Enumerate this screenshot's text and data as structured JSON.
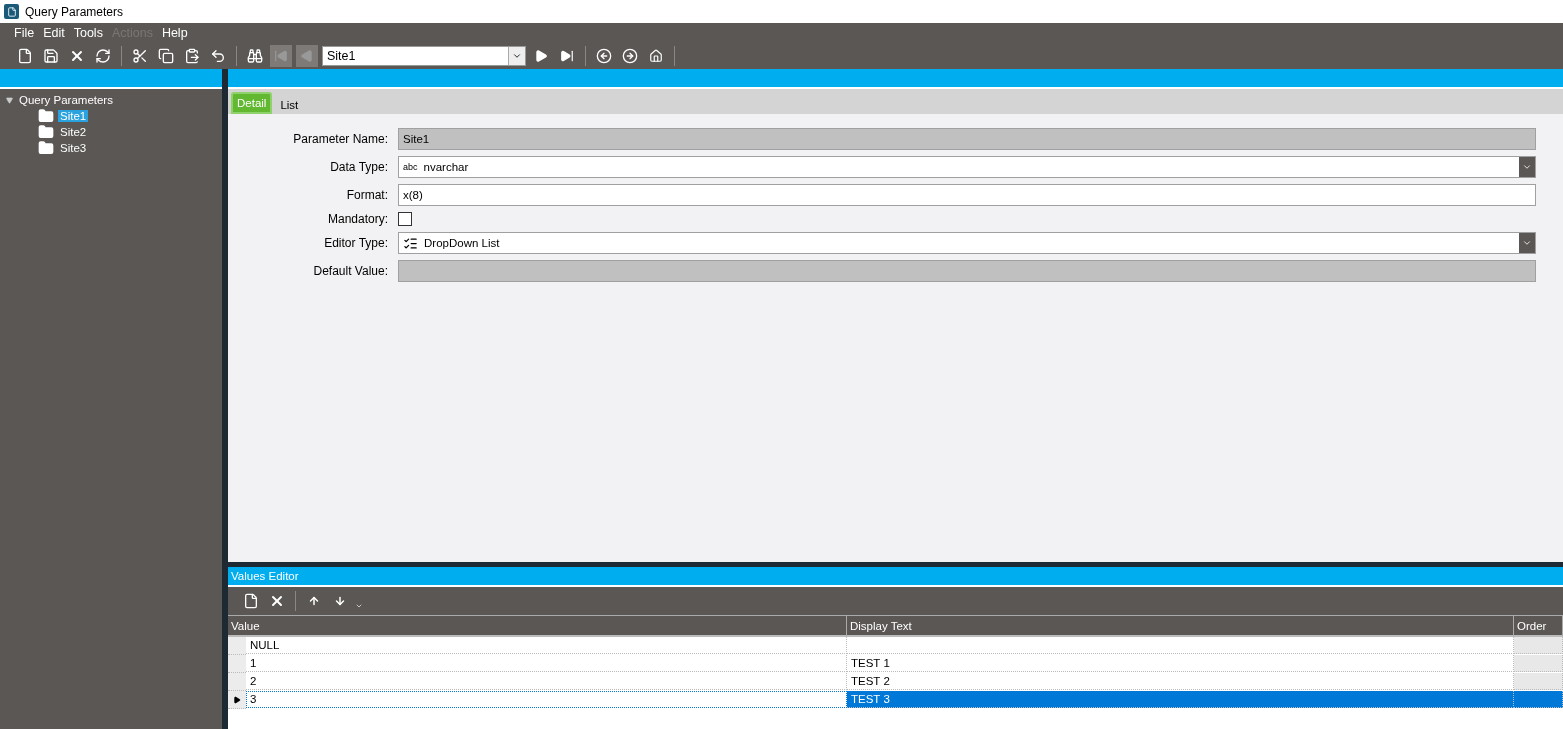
{
  "window": {
    "title": "Query Parameters"
  },
  "menu": [
    {
      "label": "File",
      "disabled": false
    },
    {
      "label": "Edit",
      "disabled": false
    },
    {
      "label": "Tools",
      "disabled": false
    },
    {
      "label": "Actions",
      "disabled": true
    },
    {
      "label": "Help",
      "disabled": false
    }
  ],
  "toolbar": {
    "nav_before": [
      {
        "kind": "first",
        "disabled": true
      },
      {
        "kind": "prev",
        "disabled": true
      }
    ],
    "record": "Site1",
    "nav_after": [
      {
        "kind": "next",
        "disabled": false
      },
      {
        "kind": "last",
        "disabled": false
      }
    ]
  },
  "tree": {
    "label": "Query Parameters",
    "expanded": true,
    "children": [
      {
        "label": "Site1",
        "selected": true
      },
      {
        "label": "Site2",
        "selected": false
      },
      {
        "label": "Site3",
        "selected": false
      }
    ]
  },
  "tabs": [
    {
      "label": "Detail",
      "selected": true
    },
    {
      "label": "List",
      "selected": false
    }
  ],
  "fields": [
    {
      "kind": "readonly",
      "label": "Parameter Name:",
      "value": "Site1"
    },
    {
      "kind": "dropdown",
      "label": "Data Type:",
      "badge": "abc",
      "value": "nvarchar"
    },
    {
      "kind": "text",
      "label": "Format:",
      "value": "x(8)"
    },
    {
      "kind": "checkbox",
      "label": "Mandatory:",
      "checked": false
    },
    {
      "kind": "dropdown",
      "label": "Editor Type:",
      "icon": true,
      "value": "DropDown List"
    },
    {
      "kind": "readonly",
      "label": "Default Value:"
    }
  ],
  "values_editor": {
    "title": "Values Editor",
    "columns": [
      "Value",
      "Display Text",
      "Order"
    ],
    "rows": [
      {
        "value": "NULL",
        "selected": false
      },
      {
        "value": "1",
        "display_text": "TEST 1",
        "selected": false
      },
      {
        "value": "2",
        "display_text": "TEST 2",
        "selected": false
      },
      {
        "value": "3",
        "display_text": "TEST 3",
        "selected": true
      }
    ]
  }
}
